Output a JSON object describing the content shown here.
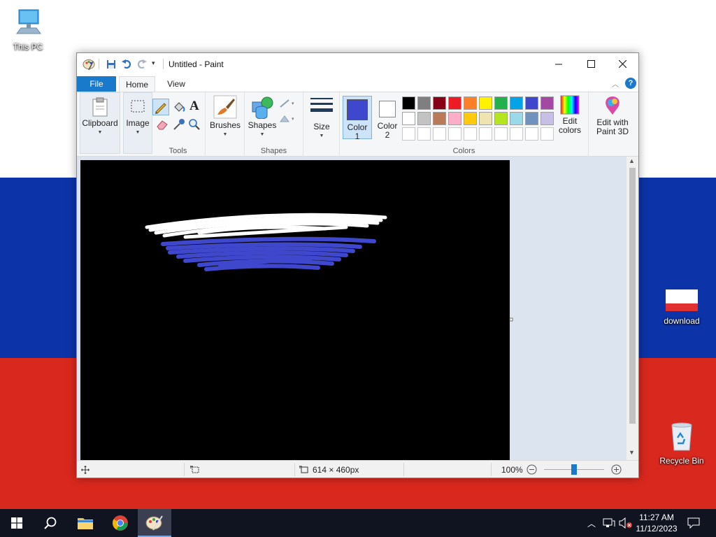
{
  "desktop": {
    "icons": [
      {
        "label": "This PC"
      },
      {
        "label": "download"
      },
      {
        "label": "Recycle Bin"
      }
    ]
  },
  "window": {
    "title": "Untitled - Paint",
    "tabs": [
      "File",
      "Home",
      "View"
    ]
  },
  "ribbon": {
    "clipboard_label": "Clipboard",
    "image_label": "Image",
    "tools_group": "Tools",
    "brushes_label": "Brushes",
    "shapes_label": "Shapes",
    "shapes_group": "Shapes",
    "size_label": "Size",
    "color1_label": [
      "Color",
      "1"
    ],
    "color2_label": [
      "Color",
      "2"
    ],
    "colors_group": "Colors",
    "edit_colors_label": [
      "Edit",
      "colors"
    ],
    "paint3d_label": [
      "Edit with",
      "Paint 3D"
    ],
    "color1_value": "#3f48cc",
    "color2_value": "#ffffff",
    "palette_row1": [
      "#000000",
      "#7f7f7f",
      "#880015",
      "#ed1c24",
      "#ff7f27",
      "#fff200",
      "#22b14c",
      "#00a2e8",
      "#3f48cc",
      "#a349a4"
    ],
    "palette_row2": [
      "#ffffff",
      "#c3c3c3",
      "#b97a57",
      "#ffaec9",
      "#ffc90e",
      "#efe4b0",
      "#b5e61d",
      "#99d9ea",
      "#7092be",
      "#c8bfe7"
    ],
    "palette_row3_count": 10
  },
  "canvas": {
    "background": "#000000",
    "strokes": [
      {
        "color": "#ffffff"
      },
      {
        "color": "#3f48cc"
      }
    ]
  },
  "status": {
    "dimensions": "614 × 460px",
    "zoom": "100%"
  },
  "taskbar": {
    "time": "11:27 AM",
    "date": "11/12/2023"
  },
  "colors": {
    "flag_white": "#ffffff",
    "flag_blue": "#0c33a8",
    "flag_red": "#d9281e",
    "accent": "#1979ca"
  }
}
